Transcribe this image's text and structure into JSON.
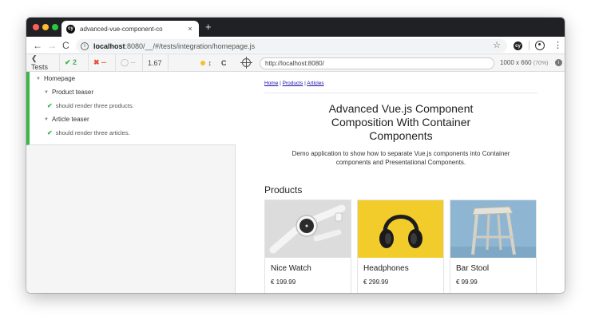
{
  "browser": {
    "tab_title": "advanced-vue-component-co",
    "tab_icon_text": "cy",
    "tab_close": "×",
    "new_tab": "+",
    "url_host": "localhost",
    "url_rest": ":8080/__/#/tests/integration/homepage.js",
    "nav_back": "←",
    "nav_forward": "→",
    "nav_reload": "C",
    "star": "☆",
    "menu": "⋮"
  },
  "runner": {
    "back_label": "❮ Tests",
    "pass_count": "✔ 2",
    "fail_count": "✖ --",
    "pending_count": "◯ --",
    "duration": "1.67",
    "status_glyph": "↕",
    "reload_glyph": "C",
    "tree": {
      "suite": "Homepage",
      "groups": [
        {
          "title": "Product teaser",
          "test": "should render three products."
        },
        {
          "title": "Article teaser",
          "test": "should render three articles."
        }
      ]
    }
  },
  "preview": {
    "url": "http://localhost:8080/",
    "viewport": "1000 x 660",
    "scale": "(70%)",
    "info": "i"
  },
  "app": {
    "nav": [
      "Home",
      "Products",
      "Articles"
    ],
    "nav_sep": " | ",
    "title": "Advanced Vue.js Component Composition With Container Components",
    "lead": "Demo application to show how to separate Vue.js components into Container components and Presentational Components.",
    "products_heading": "Products",
    "products": [
      {
        "name": "Nice Watch",
        "price": "€ 199.99"
      },
      {
        "name": "Headphones",
        "price": "€ 299.99"
      },
      {
        "name": "Bar Stool",
        "price": "€ 99.99"
      }
    ]
  },
  "colors": {
    "pass": "#3cb54a",
    "fail": "#e94f3a",
    "headphones_bg": "#f2cc2b",
    "stool_bg": "#8eb6d3"
  }
}
